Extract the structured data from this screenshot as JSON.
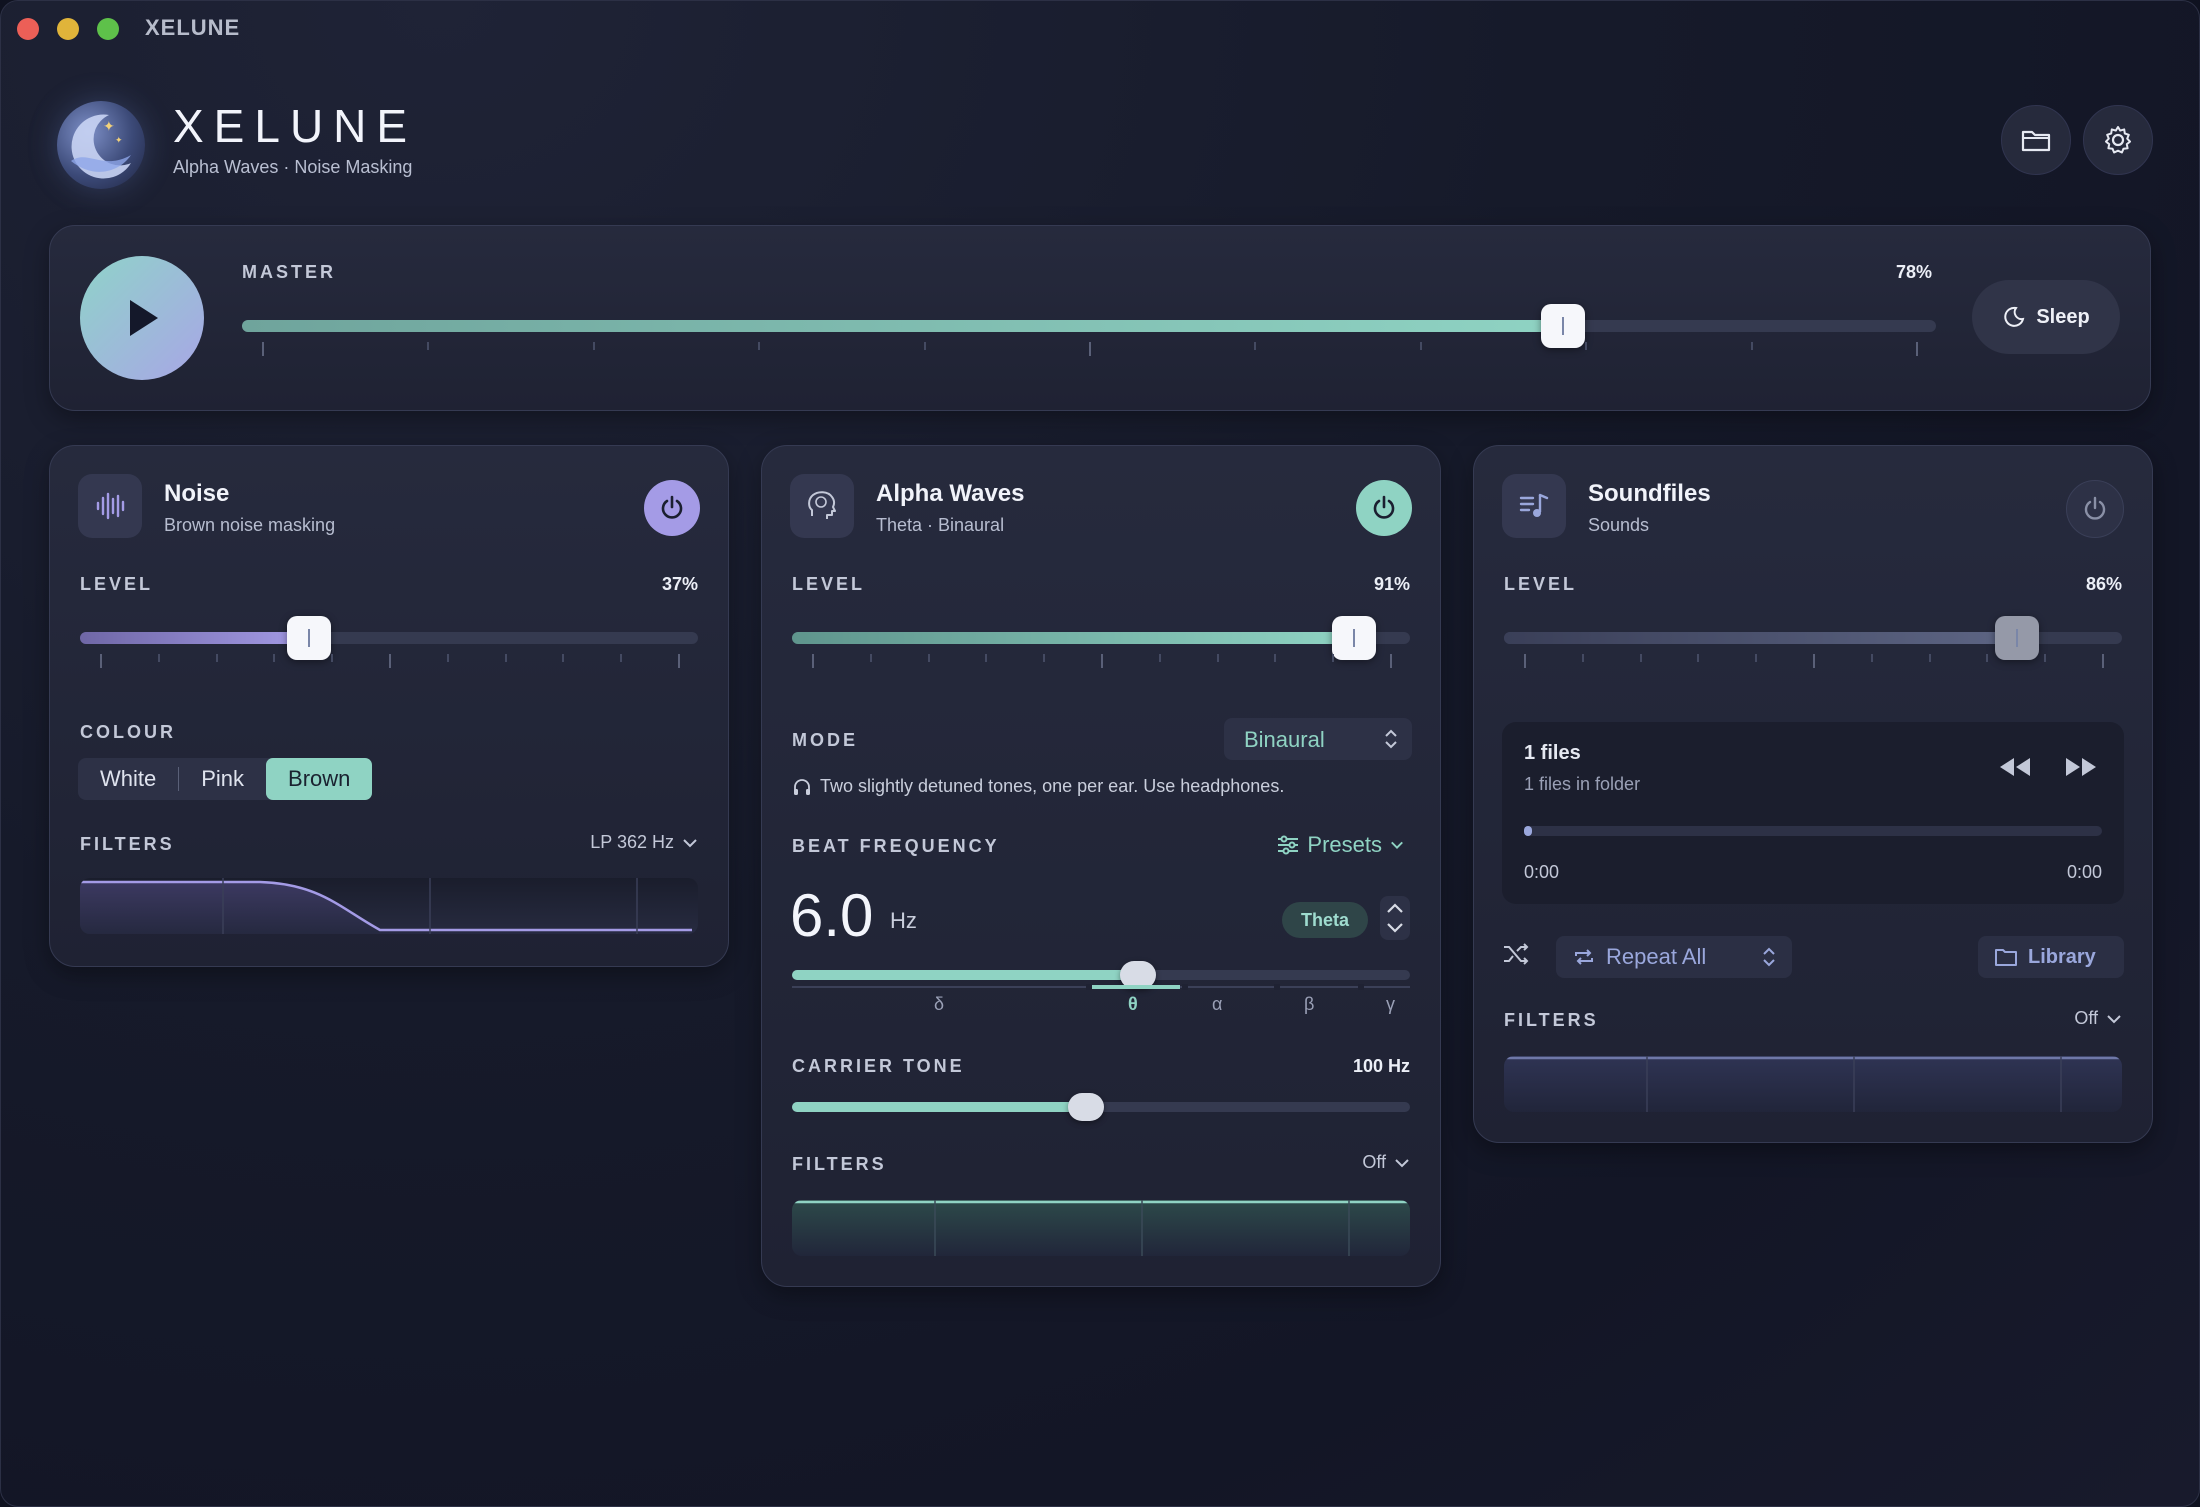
{
  "window": {
    "title": "XELUNE"
  },
  "header": {
    "app_name": "XELUNE",
    "subtitle": "Alpha Waves · Noise Masking"
  },
  "master": {
    "label": "MASTER",
    "value_text": "78%",
    "value": 0.78,
    "sleep_label": "Sleep"
  },
  "noise": {
    "title": "Noise",
    "subtitle": "Brown noise masking",
    "enabled": true,
    "level_label": "LEVEL",
    "level_text": "37%",
    "level": 0.37,
    "colour_label": "COLOUR",
    "colours": [
      "White",
      "Pink",
      "Brown"
    ],
    "selected_colour": "Brown",
    "filters_label": "FILTERS",
    "filter_value": "LP 362 Hz"
  },
  "alpha": {
    "title": "Alpha Waves",
    "subtitle": "Theta · Binaural",
    "enabled": true,
    "level_label": "LEVEL",
    "level_text": "91%",
    "level": 0.91,
    "mode_label": "MODE",
    "mode_value": "Binaural",
    "mode_hint": "Two slightly detuned tones, one per ear. Use headphones.",
    "beat_label": "BEAT FREQUENCY",
    "presets_label": "Presets",
    "beat_value": "6.0",
    "beat_unit": "Hz",
    "band_pill": "Theta",
    "beat_position": 0.56,
    "bands": [
      "δ",
      "θ",
      "α",
      "β",
      "γ"
    ],
    "active_band": "θ",
    "carrier_label": "CARRIER TONE",
    "carrier_text": "100 Hz",
    "carrier_position": 0.475,
    "filters_label": "FILTERS",
    "filter_value": "Off"
  },
  "soundfiles": {
    "title": "Soundfiles",
    "subtitle": "Sounds",
    "enabled": false,
    "level_label": "LEVEL",
    "level_text": "86%",
    "level": 0.83,
    "player_title": "1 files",
    "player_sub": "1 files in folder",
    "time_start": "0:00",
    "time_end": "0:00",
    "repeat_label": "Repeat All",
    "library_label": "Library",
    "filters_label": "FILTERS",
    "filter_value": "Off"
  },
  "colors": {
    "accent_teal": "#8fd3c3",
    "accent_purple": "#a49be6",
    "background": "#14172a"
  }
}
